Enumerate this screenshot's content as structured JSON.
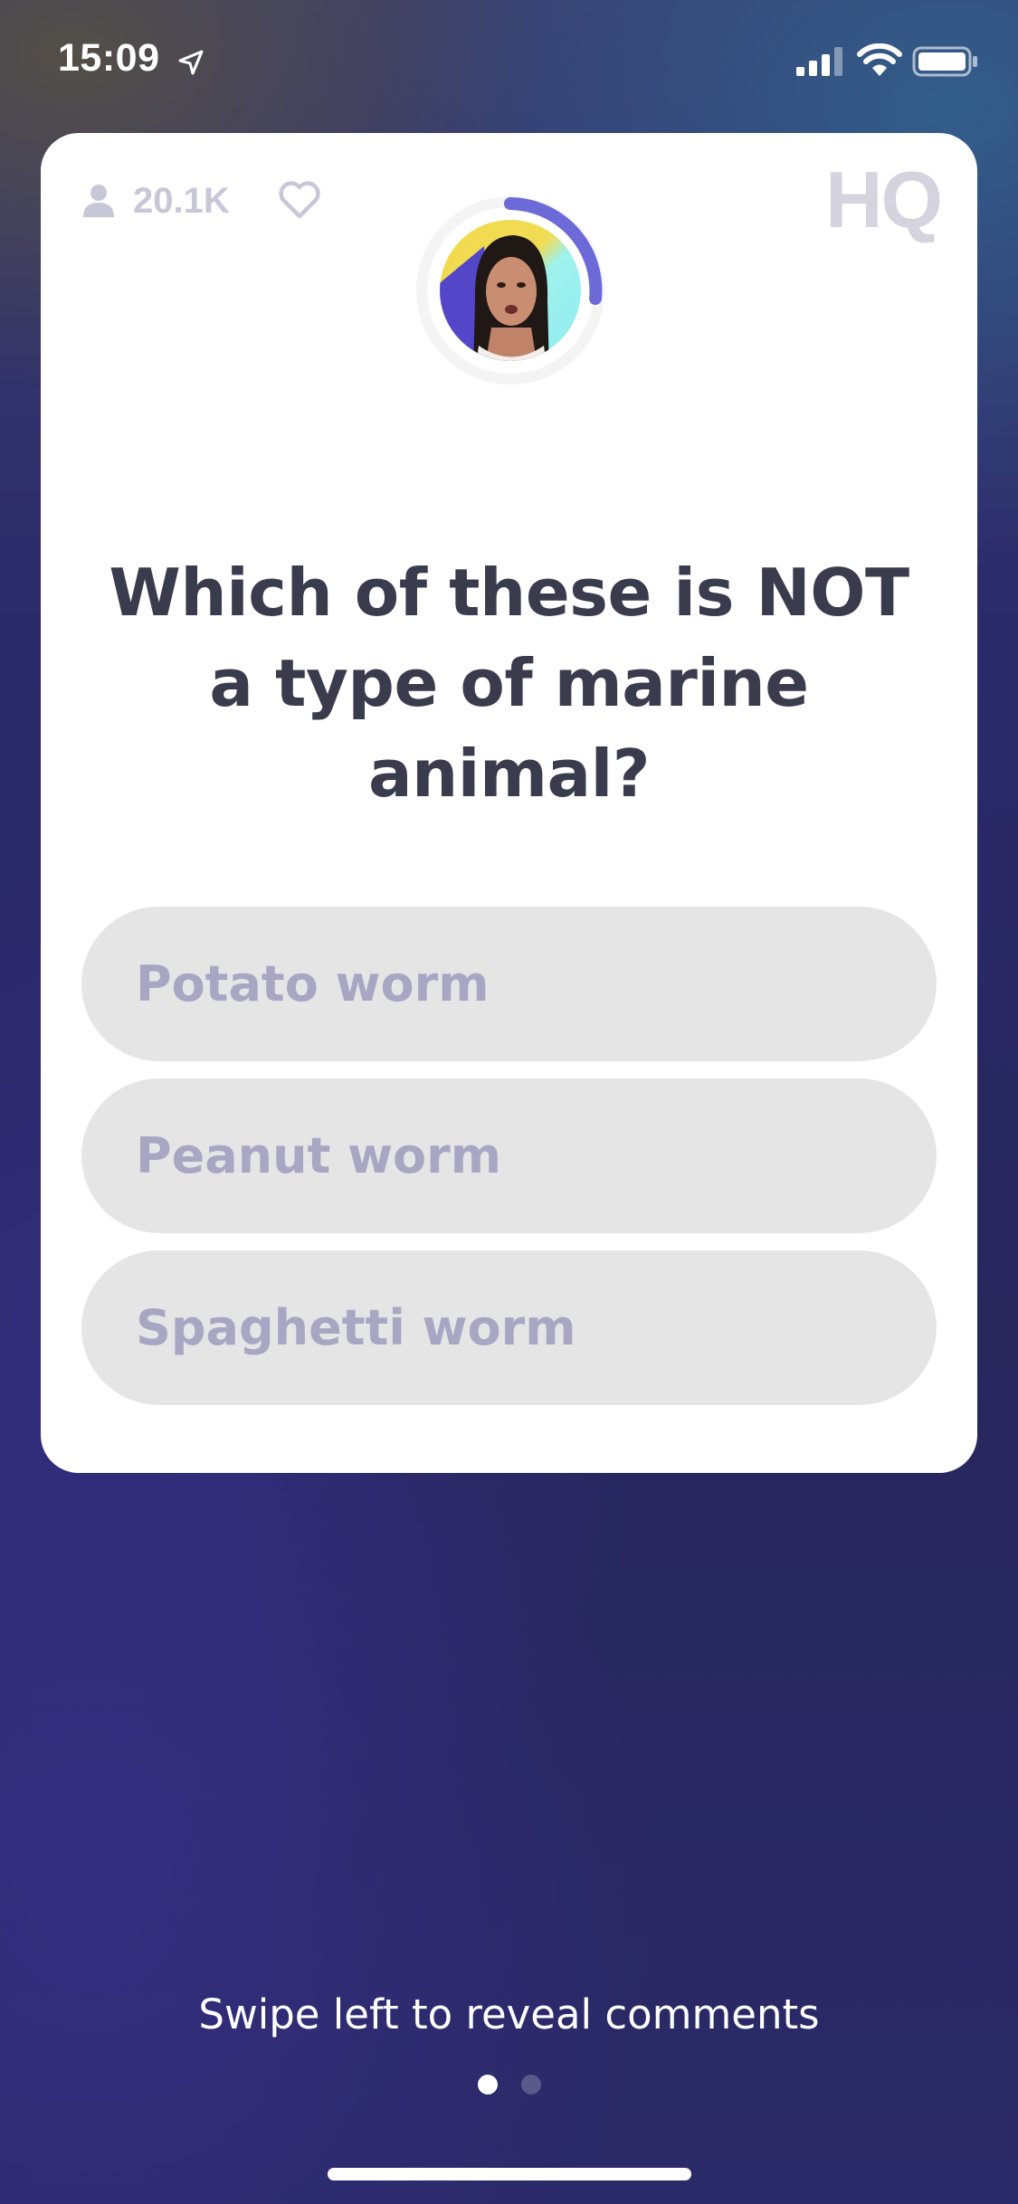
{
  "status_bar": {
    "time": "15:09",
    "icons": [
      "location-arrow-icon",
      "cellular-signal-icon",
      "wifi-icon",
      "battery-icon"
    ]
  },
  "card": {
    "viewer_count": "20.1K",
    "logo": "HQ",
    "host_icon": "host-avatar",
    "timer_color": "#6b6ad8",
    "question": "Which of these is NOT a type of marine animal?",
    "answers": [
      {
        "label": "Potato worm"
      },
      {
        "label": "Peanut worm"
      },
      {
        "label": "Spaghetti worm"
      }
    ]
  },
  "footer": {
    "swipe_hint": "Swipe left to reveal comments",
    "pages": {
      "current": 1,
      "total": 2
    }
  },
  "colors": {
    "answer_bg": "#e5e5e5",
    "answer_text": "#a9a6c4",
    "question_text": "#3b3b4e",
    "background": "#2b2a68"
  }
}
